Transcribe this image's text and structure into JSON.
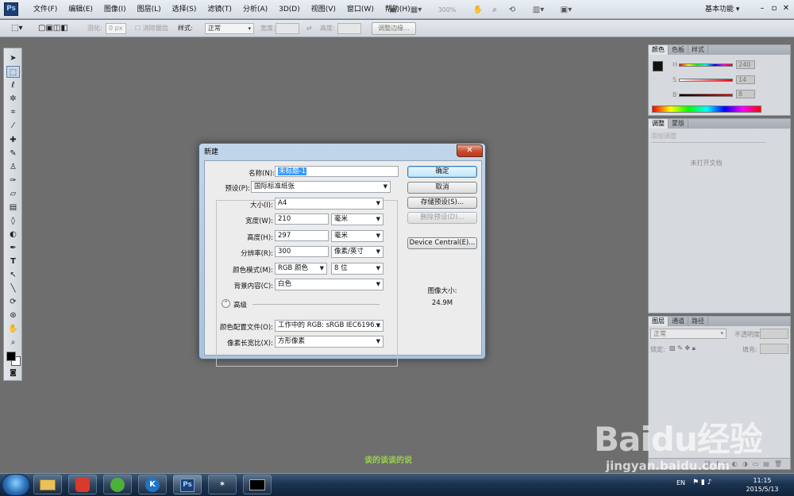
{
  "app": {
    "logo": "Ps"
  },
  "menubar": {
    "items": [
      "文件(F)",
      "编辑(E)",
      "图像(I)",
      "图层(L)",
      "选择(S)",
      "滤镜(T)",
      "分析(A)",
      "3D(D)",
      "视图(V)",
      "窗口(W)",
      "帮助(H)"
    ],
    "zoom": "300%",
    "workspace": "基本功能 ▾"
  },
  "optionsbar": {
    "feather_label": "羽化:",
    "feather_value": "0 px",
    "antialias_label": "消除锯齿",
    "style_label": "样式:",
    "style_value": "正常",
    "width_label": "宽度:",
    "height_label": "高度:",
    "refine_button": "调整边缘..."
  },
  "panels": {
    "color": {
      "tabs": [
        "颜色",
        "色板",
        "样式"
      ],
      "h_label": "H",
      "h_value": "240",
      "s_label": "S",
      "s_value": "14",
      "b_label": "B",
      "b_value": "8"
    },
    "adjust": {
      "tabs": [
        "调整",
        "蒙版"
      ],
      "add_label": "添加调整",
      "empty_text": "未打开文档"
    },
    "layers": {
      "tabs": [
        "图层",
        "通道",
        "路径"
      ],
      "blend_value": "正常",
      "opacity_label": "不透明度:",
      "lock_label": "锁定:",
      "fill_label": "填充:"
    }
  },
  "dialog": {
    "title": "新建",
    "close": "✕",
    "name_label": "名称(N):",
    "name_value": "未标题-1",
    "preset_label": "预设(P):",
    "preset_value": "国际标准纸张",
    "size_label": "大小(I):",
    "size_value": "A4",
    "width_label": "宽度(W):",
    "width_value": "210",
    "width_unit": "毫米",
    "height_label": "高度(H):",
    "height_value": "297",
    "height_unit": "毫米",
    "resolution_label": "分辨率(R):",
    "resolution_value": "300",
    "resolution_unit": "像素/英寸",
    "colormode_label": "颜色模式(M):",
    "colormode_value": "RGB 颜色",
    "bitdepth_value": "8 位",
    "background_label": "背景内容(C):",
    "background_value": "白色",
    "advanced_label": "高级",
    "profile_label": "颜色配置文件(O):",
    "profile_value": "工作中的 RGB: sRGB IEC6196...",
    "aspect_label": "像素长宽比(X):",
    "aspect_value": "方形像素",
    "ok_button": "确定",
    "cancel_button": "取消",
    "save_preset_button": "存储预设(S)...",
    "delete_preset_button": "删除预设(D)...",
    "device_central_button": "Device Central(E)...",
    "image_size_label": "图像大小:",
    "image_size_value": "24.9M"
  },
  "taskbar": {
    "lang": "EN",
    "time": "11:15",
    "date": "2015/5/13",
    "ps_label": "Ps",
    "k_label": "K"
  },
  "watermark": {
    "brand": "Baidu经验",
    "url": "jingyan.baidu.com",
    "caption": "谈的谈谈的说"
  }
}
